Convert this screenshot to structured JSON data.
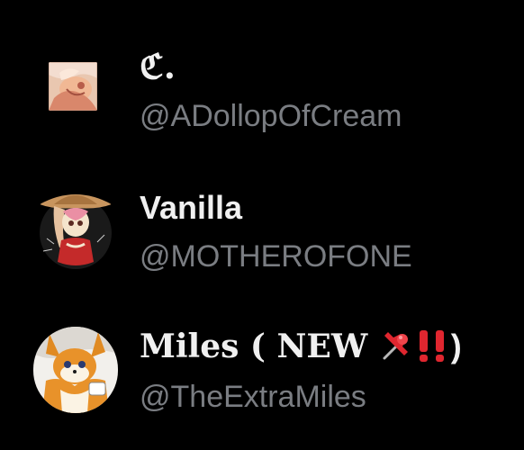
{
  "accounts": [
    {
      "display_name": "ℭ.",
      "handle": "@ADollopOfCream",
      "avatar_icon": "avatar-cream-art-icon"
    },
    {
      "display_name": "Vanilla",
      "handle": "@MOTHEROFONE",
      "avatar_icon": "avatar-vanilla-art-icon"
    },
    {
      "display_name_prefix": "Miles ( NEW ",
      "display_name_suffix": ")",
      "display_name_emoji": [
        "pushpin-emoji-icon",
        "double-exclamation-emoji-icon"
      ],
      "handle": "@TheExtraMiles",
      "avatar_icon": "avatar-tails-art-icon"
    }
  ],
  "colors": {
    "background": "#000000",
    "display_name": "#f0f0f0",
    "handle": "#7a7d82",
    "emoji_red": "#e0262f"
  }
}
